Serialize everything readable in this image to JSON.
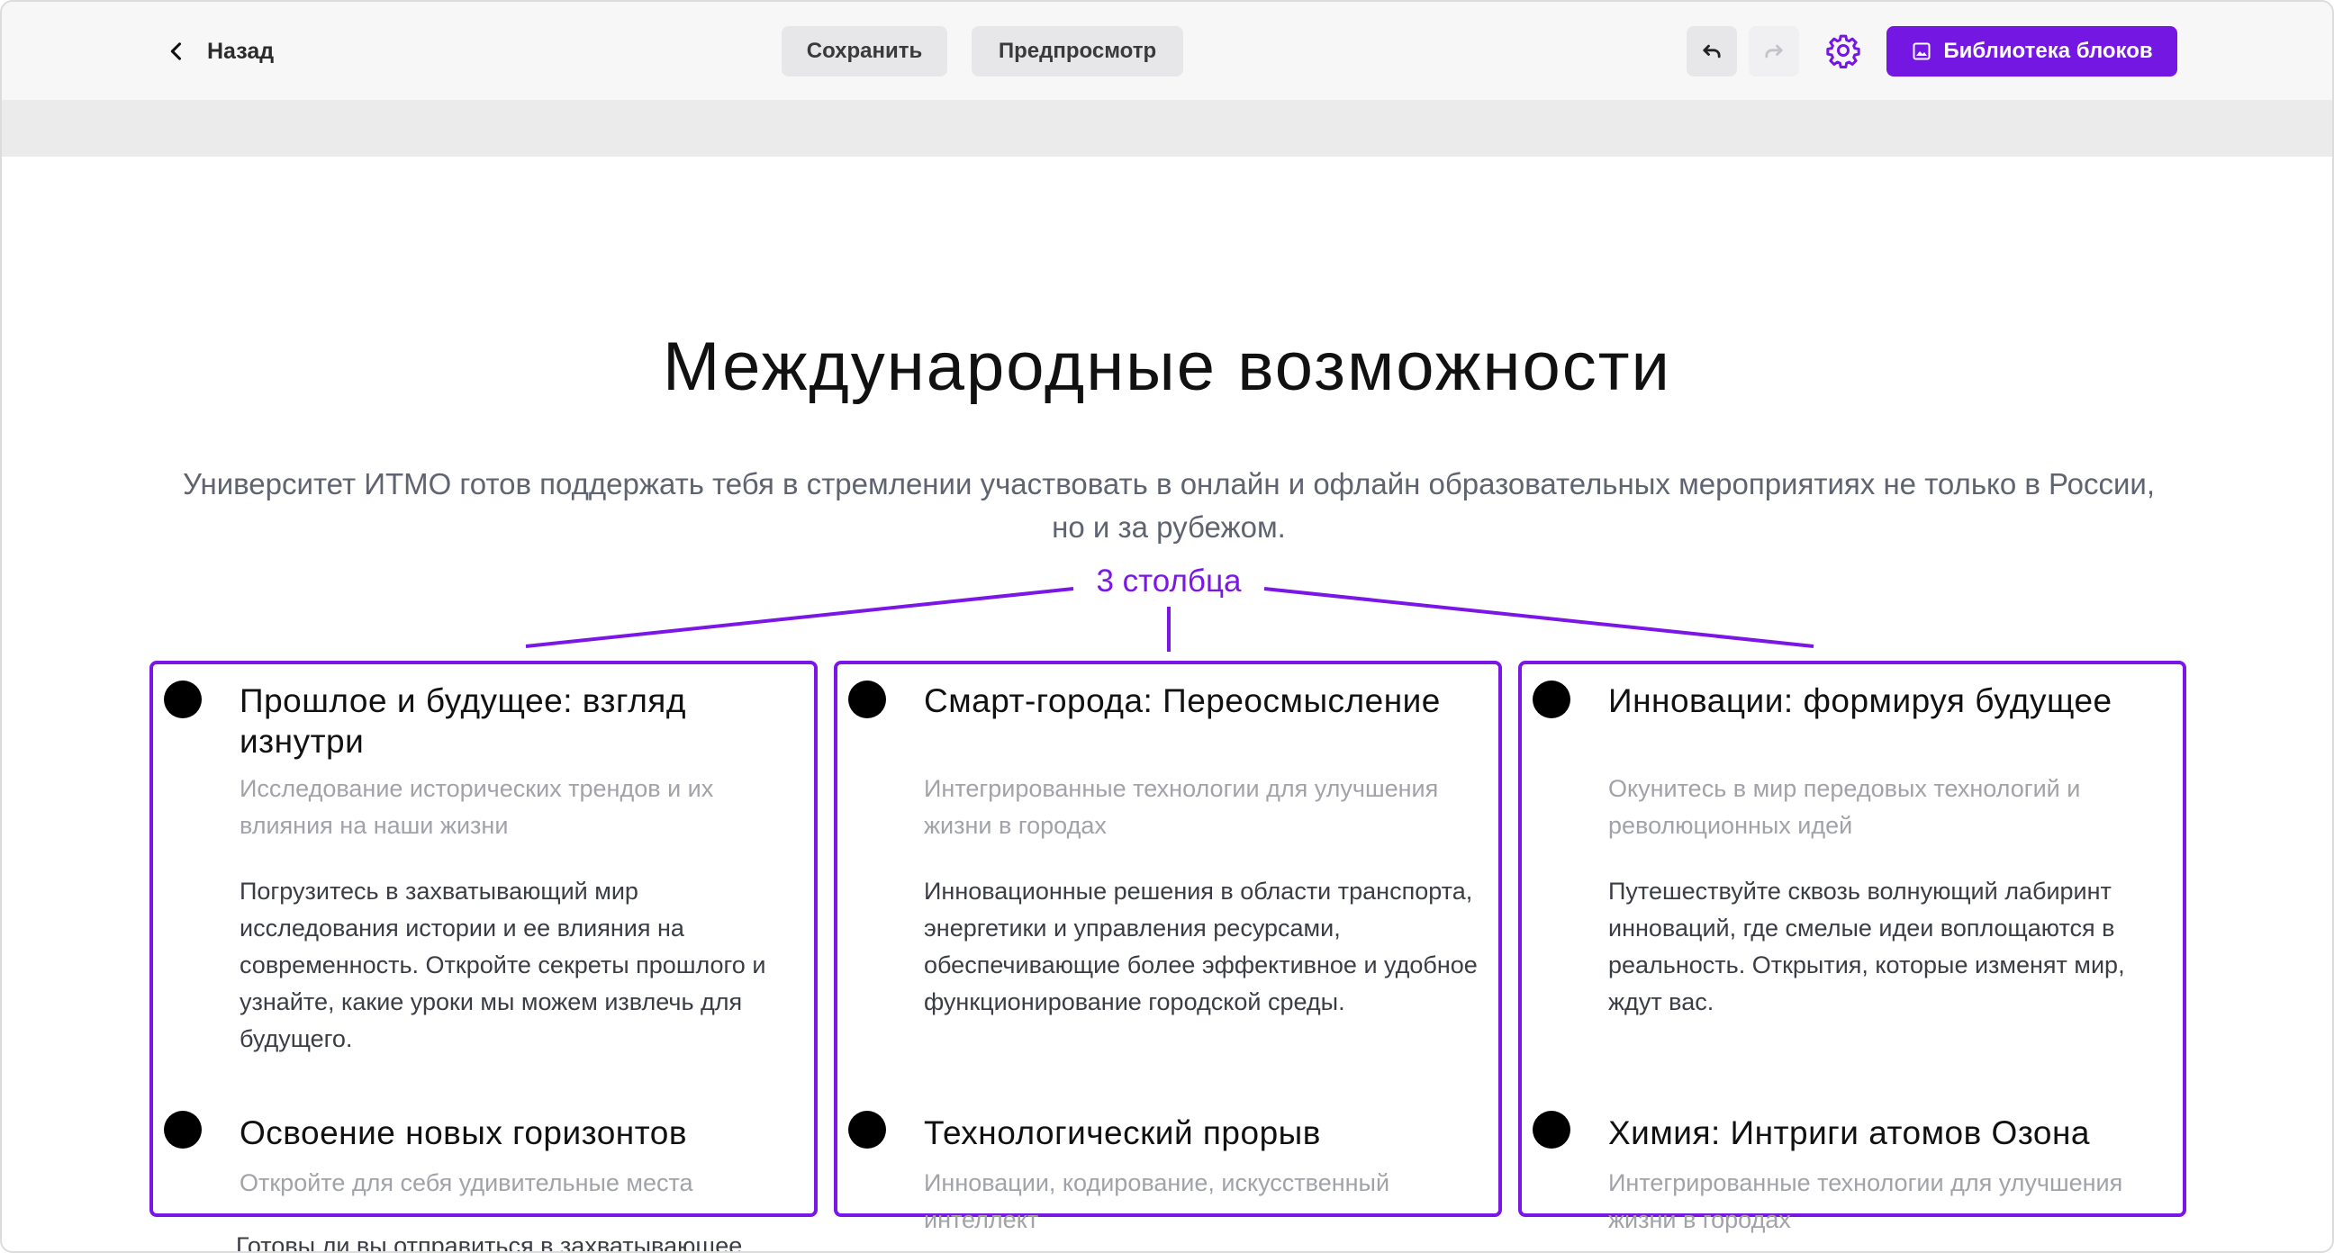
{
  "toolbar": {
    "back_label": "Назад",
    "save_label": "Сохранить",
    "preview_label": "Предпросмотр",
    "library_label": "Библиотека блоков",
    "accent_color": "#7417e3"
  },
  "content": {
    "heading": "Международные возможности",
    "subtitle": "Университет ИТМО готов поддержать тебя в стремлении участвовать в онлайн и офлайн образовательных мероприятиях не только в России, но и за рубежом.",
    "annotation": "3 столбца",
    "columns": [
      {
        "items": [
          {
            "title": "Прошлое и будущее: взгляд изнутри",
            "subtitle": "Исследование исторических трендов и их влияния на наши жизни",
            "body": "Погрузитесь в захватывающий мир исследования истории и ее влияния на современность. Откройте секреты прошлого и узнайте, какие уроки мы можем извлечь для будущего."
          },
          {
            "title": "Освоение новых горизонтов",
            "subtitle": "Откройте для себя удивительные места",
            "body": "Готовы ли вы отправиться в захватывающее"
          }
        ]
      },
      {
        "items": [
          {
            "title": "Смарт-города: Переосмысление",
            "subtitle": "Интегрированные технологии для улучшения жизни в городах",
            "body": "Инновационные решения в области транспорта, энергетики и управления ресурсами, обеспечивающие более эффективное и удобное функционирование городской среды."
          },
          {
            "title": "Технологический прорыв",
            "subtitle": "Инновации, кодирование, искусственный интеллект",
            "body": ""
          }
        ]
      },
      {
        "items": [
          {
            "title": "Инновации: формируя будущее",
            "subtitle": "Окунитесь в мир передовых технологий и революционных идей",
            "body": "Путешествуйте сквозь волнующий лабиринт инноваций, где смелые идеи воплощаются в реальность. Открытия, которые изменят мир, ждут вас."
          },
          {
            "title": "Химия: Интриги атомов Озона",
            "subtitle": "Интегрированные технологии для улучшения жизни в городах",
            "body": ""
          }
        ]
      }
    ]
  }
}
